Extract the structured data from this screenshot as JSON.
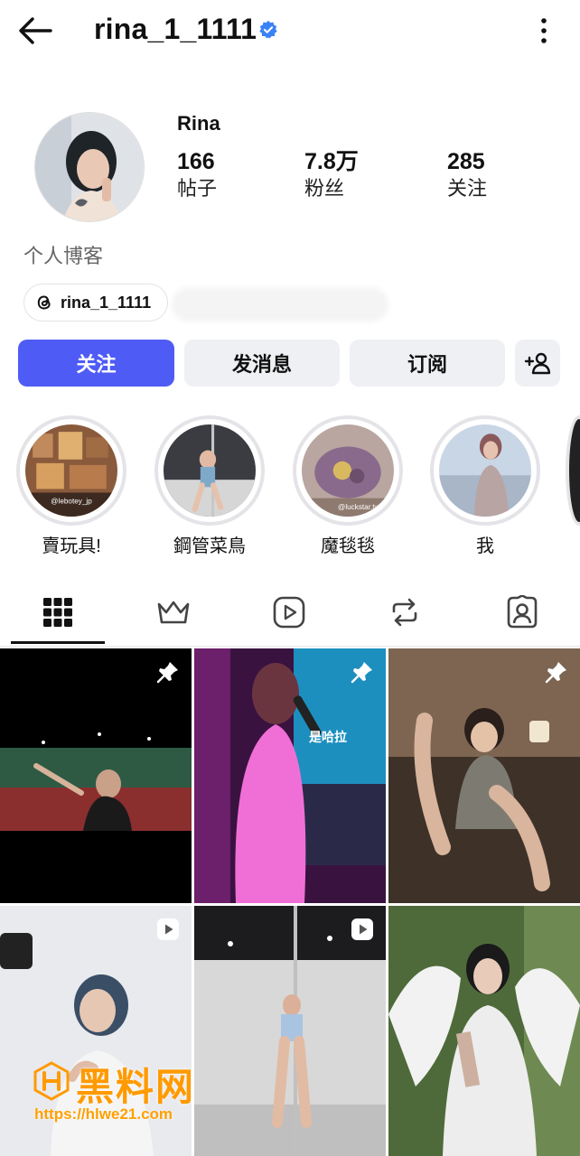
{
  "header": {
    "username": "rina_1_1111",
    "verified": true,
    "back_icon": "arrow-left-icon",
    "more_icon": "more-vertical-icon"
  },
  "profile": {
    "display_name": "Rina",
    "stats": [
      {
        "value": "166",
        "label": "帖子"
      },
      {
        "value": "7.8万",
        "label": "粉丝"
      },
      {
        "value": "285",
        "label": "关注"
      }
    ],
    "bio": "个人博客",
    "threads_handle": "rina_1_1111"
  },
  "actions": {
    "follow": "关注",
    "message": "发消息",
    "subscribe": "订阅",
    "add_user": "+8"
  },
  "highlights": [
    {
      "label": "賣玩具!",
      "overlay": "@lebotey_jp"
    },
    {
      "label": "鋼管菜鳥",
      "overlay": ""
    },
    {
      "label": "魔毯毯",
      "overlay": "@luckstar.tw"
    },
    {
      "label": "我",
      "overlay": ""
    }
  ],
  "tabs": [
    {
      "name": "grid",
      "icon": "grid-icon",
      "active": true
    },
    {
      "name": "subscriptions",
      "icon": "crown-icon",
      "active": false
    },
    {
      "name": "reels",
      "icon": "reels-icon",
      "active": false
    },
    {
      "name": "reposts",
      "icon": "repost-icon",
      "active": false
    },
    {
      "name": "tagged",
      "icon": "tagged-person-icon",
      "active": false
    }
  ],
  "posts": [
    {
      "type": "pinned",
      "caption": ""
    },
    {
      "type": "pinned",
      "caption": "是哈拉"
    },
    {
      "type": "pinned",
      "caption": ""
    },
    {
      "type": "reel",
      "caption": ""
    },
    {
      "type": "reel",
      "caption": ""
    },
    {
      "type": "photo",
      "caption": ""
    }
  ],
  "watermark": {
    "text": "黑料网",
    "url": "https://hlwe21.com"
  },
  "colors": {
    "accent": "#4f5bf5",
    "button_grey": "#eef0f3",
    "verified": "#3b82f6",
    "watermark": "#ff9a00"
  }
}
